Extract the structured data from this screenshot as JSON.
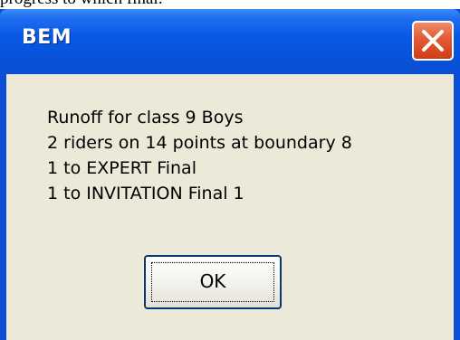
{
  "page_caption": "progress to which final:",
  "dialog": {
    "title": "BEM",
    "close_icon": "close-x-icon",
    "message_lines": [
      "Runoff for class 9 Boys",
      "2 riders on 14 points at boundary 8",
      "1 to EXPERT Final",
      "1 to INVITATION Final 1"
    ],
    "ok_label": "OK"
  },
  "colors": {
    "titlebar": "#0a5ae6",
    "close_button": "#e25a32",
    "client_background": "#ece9d8"
  }
}
